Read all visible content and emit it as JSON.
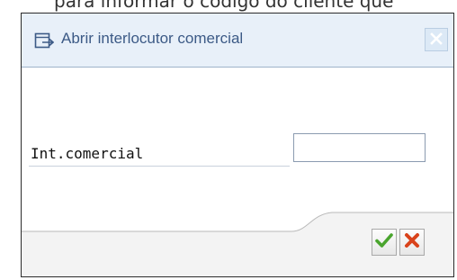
{
  "background": {
    "clipped_text": "para informar o código do cliente que"
  },
  "dialog": {
    "title": "Abrir interlocutor comercial",
    "icons": {
      "title": "open-document-icon",
      "close": "close-icon"
    }
  },
  "form": {
    "label": "Int.comercial",
    "value": "",
    "placeholder": ""
  },
  "footer": {
    "ok_icon": "checkmark-icon",
    "cancel_icon": "cancel-x-icon"
  },
  "colors": {
    "title_bg": "#e8f0f9",
    "title_text": "#3c5a86",
    "ok_green": "#4aa52e",
    "cancel_red": "#d9431b"
  }
}
